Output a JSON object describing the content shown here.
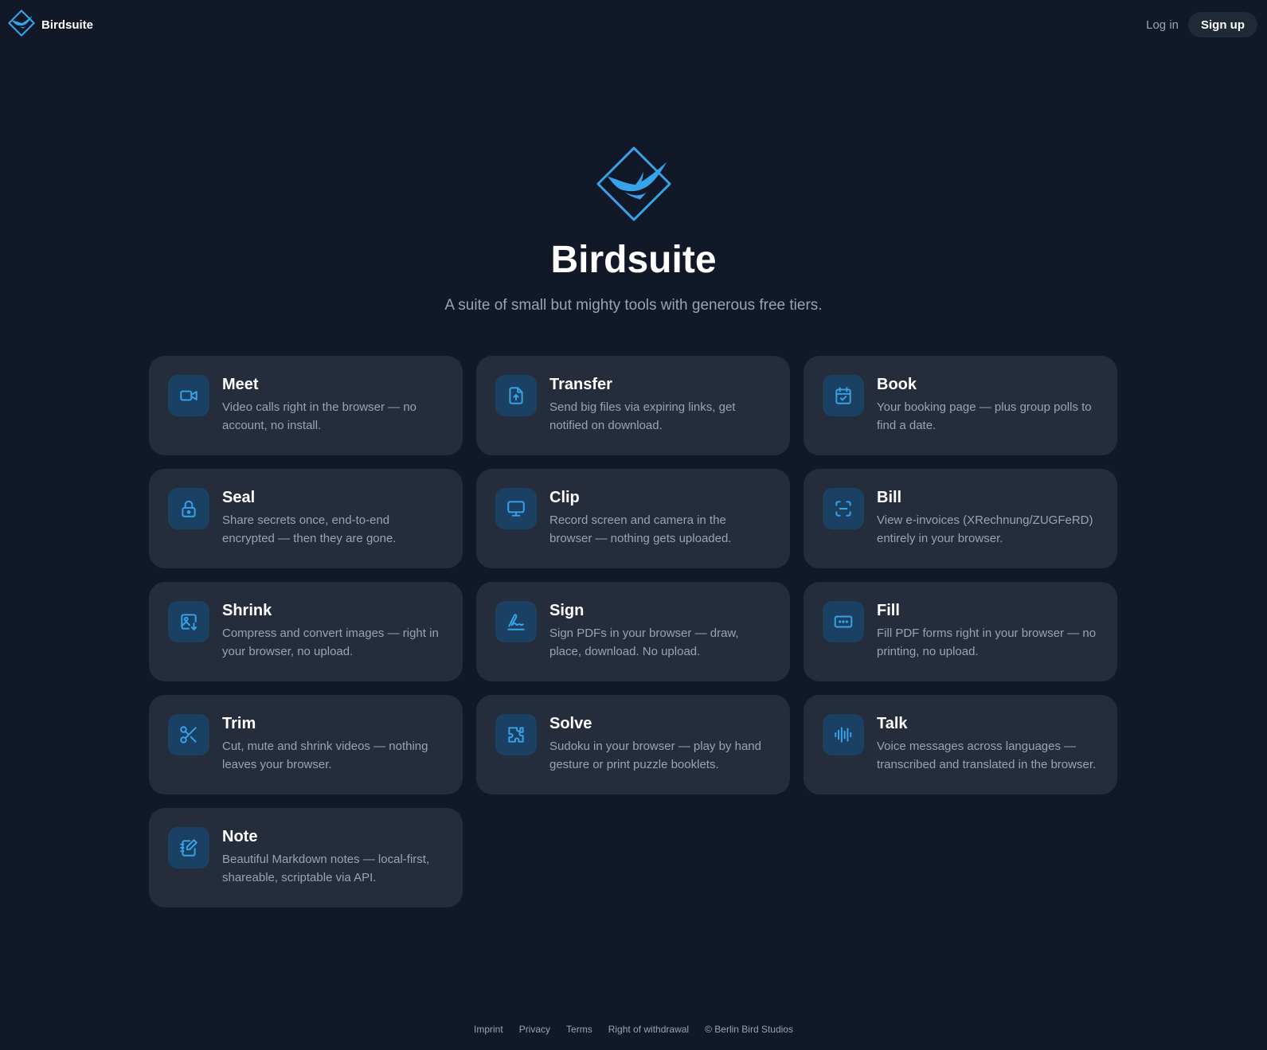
{
  "colors": {
    "background": "#111827",
    "card": "#252c3c",
    "accent": "#38a3e8",
    "icon_bg": "#1a4163",
    "muted_text": "#9ca3af"
  },
  "header": {
    "brand": "Birdsuite",
    "logo_icon": "bird-diamond-logo",
    "login_label": "Log in",
    "signup_label": "Sign up"
  },
  "hero": {
    "logo_icon": "bird-diamond-logo",
    "title": "Birdsuite",
    "subtitle": "A suite of small but mighty tools with generous free tiers."
  },
  "tools": [
    {
      "name": "Meet",
      "icon": "video-camera-icon",
      "description": "Video calls right in the browser — no account, no install."
    },
    {
      "name": "Transfer",
      "icon": "file-upload-icon",
      "description": "Send big files via expiring links, get notified on download."
    },
    {
      "name": "Book",
      "icon": "calendar-check-icon",
      "description": "Your booking page — plus group polls to find a date."
    },
    {
      "name": "Seal",
      "icon": "lock-icon",
      "description": "Share secrets once, end-to-end encrypted — then they are gone."
    },
    {
      "name": "Clip",
      "icon": "monitor-icon",
      "description": "Record screen and camera in the browser — nothing gets uploaded."
    },
    {
      "name": "Bill",
      "icon": "scan-icon",
      "description": "View e-invoices (XRechnung/ZUGFeRD) entirely in your browser."
    },
    {
      "name": "Shrink",
      "icon": "image-download-icon",
      "description": "Compress and convert images — right in your browser, no upload."
    },
    {
      "name": "Sign",
      "icon": "signature-icon",
      "description": "Sign PDFs in your browser — draw, place, download. No upload."
    },
    {
      "name": "Fill",
      "icon": "form-field-icon",
      "description": "Fill PDF forms right in your browser — no printing, no upload."
    },
    {
      "name": "Trim",
      "icon": "scissors-icon",
      "description": "Cut, mute and shrink videos — nothing leaves your browser."
    },
    {
      "name": "Solve",
      "icon": "puzzle-icon",
      "description": "Sudoku in your browser — play by hand gesture or print puzzle booklets."
    },
    {
      "name": "Talk",
      "icon": "audio-waveform-icon",
      "description": "Voice messages across languages — transcribed and translated in the browser."
    },
    {
      "name": "Note",
      "icon": "notebook-pen-icon",
      "description": "Beautiful Markdown notes — local-first, shareable, scriptable via API."
    }
  ],
  "footer": {
    "links": [
      "Imprint",
      "Privacy",
      "Terms",
      "Right of withdrawal"
    ],
    "copyright": "© Berlin Bird Studios"
  }
}
